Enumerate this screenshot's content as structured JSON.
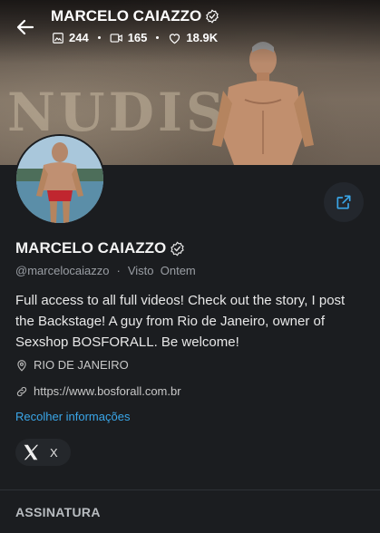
{
  "header": {
    "title": "MARCELO CAIAZZO",
    "stats": {
      "photos": "244",
      "videos": "165",
      "likes": "18.9K"
    }
  },
  "cover": {
    "sand_text": "NUDIS"
  },
  "profile": {
    "name": "MARCELO CAIAZZO",
    "handle": "@marcelocaiazzo",
    "separator": "·",
    "last_seen": "Visto  Ontem",
    "bio": "Full access to all full videos! Check out the story, I post the Backstage! A guy from Rio de Janeiro, owner of Sexshop BOSFORALL. Be welcome!",
    "location": "RIO DE JANEIRO",
    "website": "https://www.bosforall.com.br",
    "collapse_label": "Recolher informações",
    "social": {
      "label": "X"
    }
  },
  "sections": {
    "subscription": "ASSINATURA"
  },
  "colors": {
    "background": "#1b1d20",
    "accent": "#3aa6e8"
  }
}
